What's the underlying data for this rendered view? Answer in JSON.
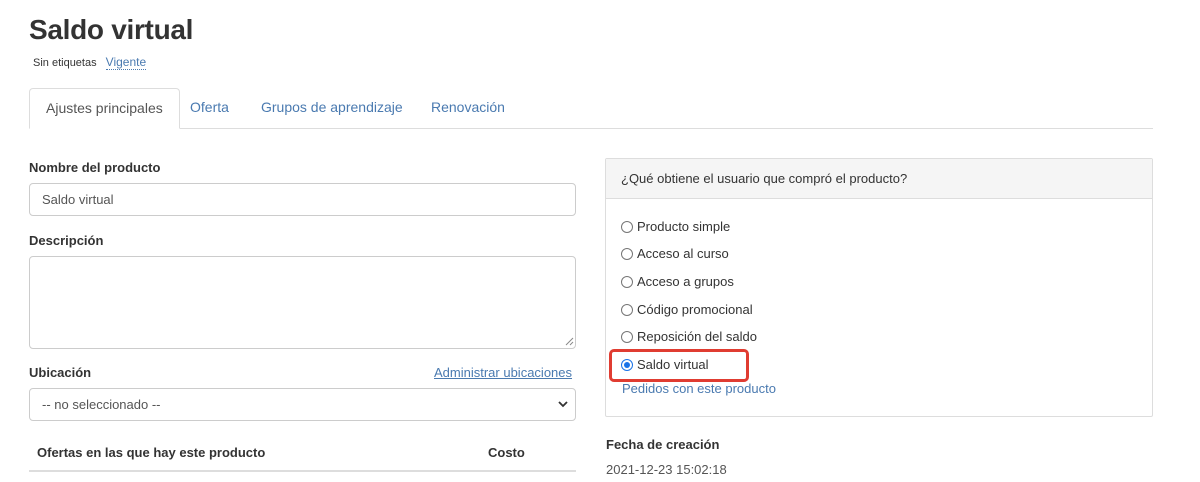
{
  "page": {
    "title": "Saldo virtual",
    "tags_label": "Sin etiquetas",
    "status": "Vigente"
  },
  "tabs": [
    {
      "label": "Ajustes principales",
      "active": true
    },
    {
      "label": "Oferta",
      "active": false
    },
    {
      "label": "Grupos de aprendizaje",
      "active": false
    },
    {
      "label": "Renovación",
      "active": false
    }
  ],
  "form": {
    "name_label": "Nombre del producto",
    "name_value": "Saldo virtual",
    "description_label": "Descripción",
    "description_value": "",
    "location_label": "Ubicación",
    "manage_locations_link": "Administrar ubicaciones",
    "location_selected": "-- no seleccionado --"
  },
  "offers_table": {
    "columns": [
      "Ofertas en las que hay este producto",
      "Costo"
    ]
  },
  "panel": {
    "header": "¿Qué obtiene el usuario que compró el producto?",
    "options": [
      {
        "label": "Producto simple",
        "checked": false
      },
      {
        "label": "Acceso al curso",
        "checked": false
      },
      {
        "label": "Acceso a grupos",
        "checked": false
      },
      {
        "label": "Código promocional",
        "checked": false
      },
      {
        "label": "Reposición del saldo",
        "checked": false
      },
      {
        "label": "Saldo virtual",
        "checked": true
      }
    ],
    "orders_link": "Pedidos con este producto"
  },
  "created": {
    "label": "Fecha de creación",
    "value": "2021-12-23 15:02:18"
  },
  "colors": {
    "link": "#4a7ab0",
    "highlight": "#e03c31",
    "radio_checked": "#1a73e8"
  }
}
